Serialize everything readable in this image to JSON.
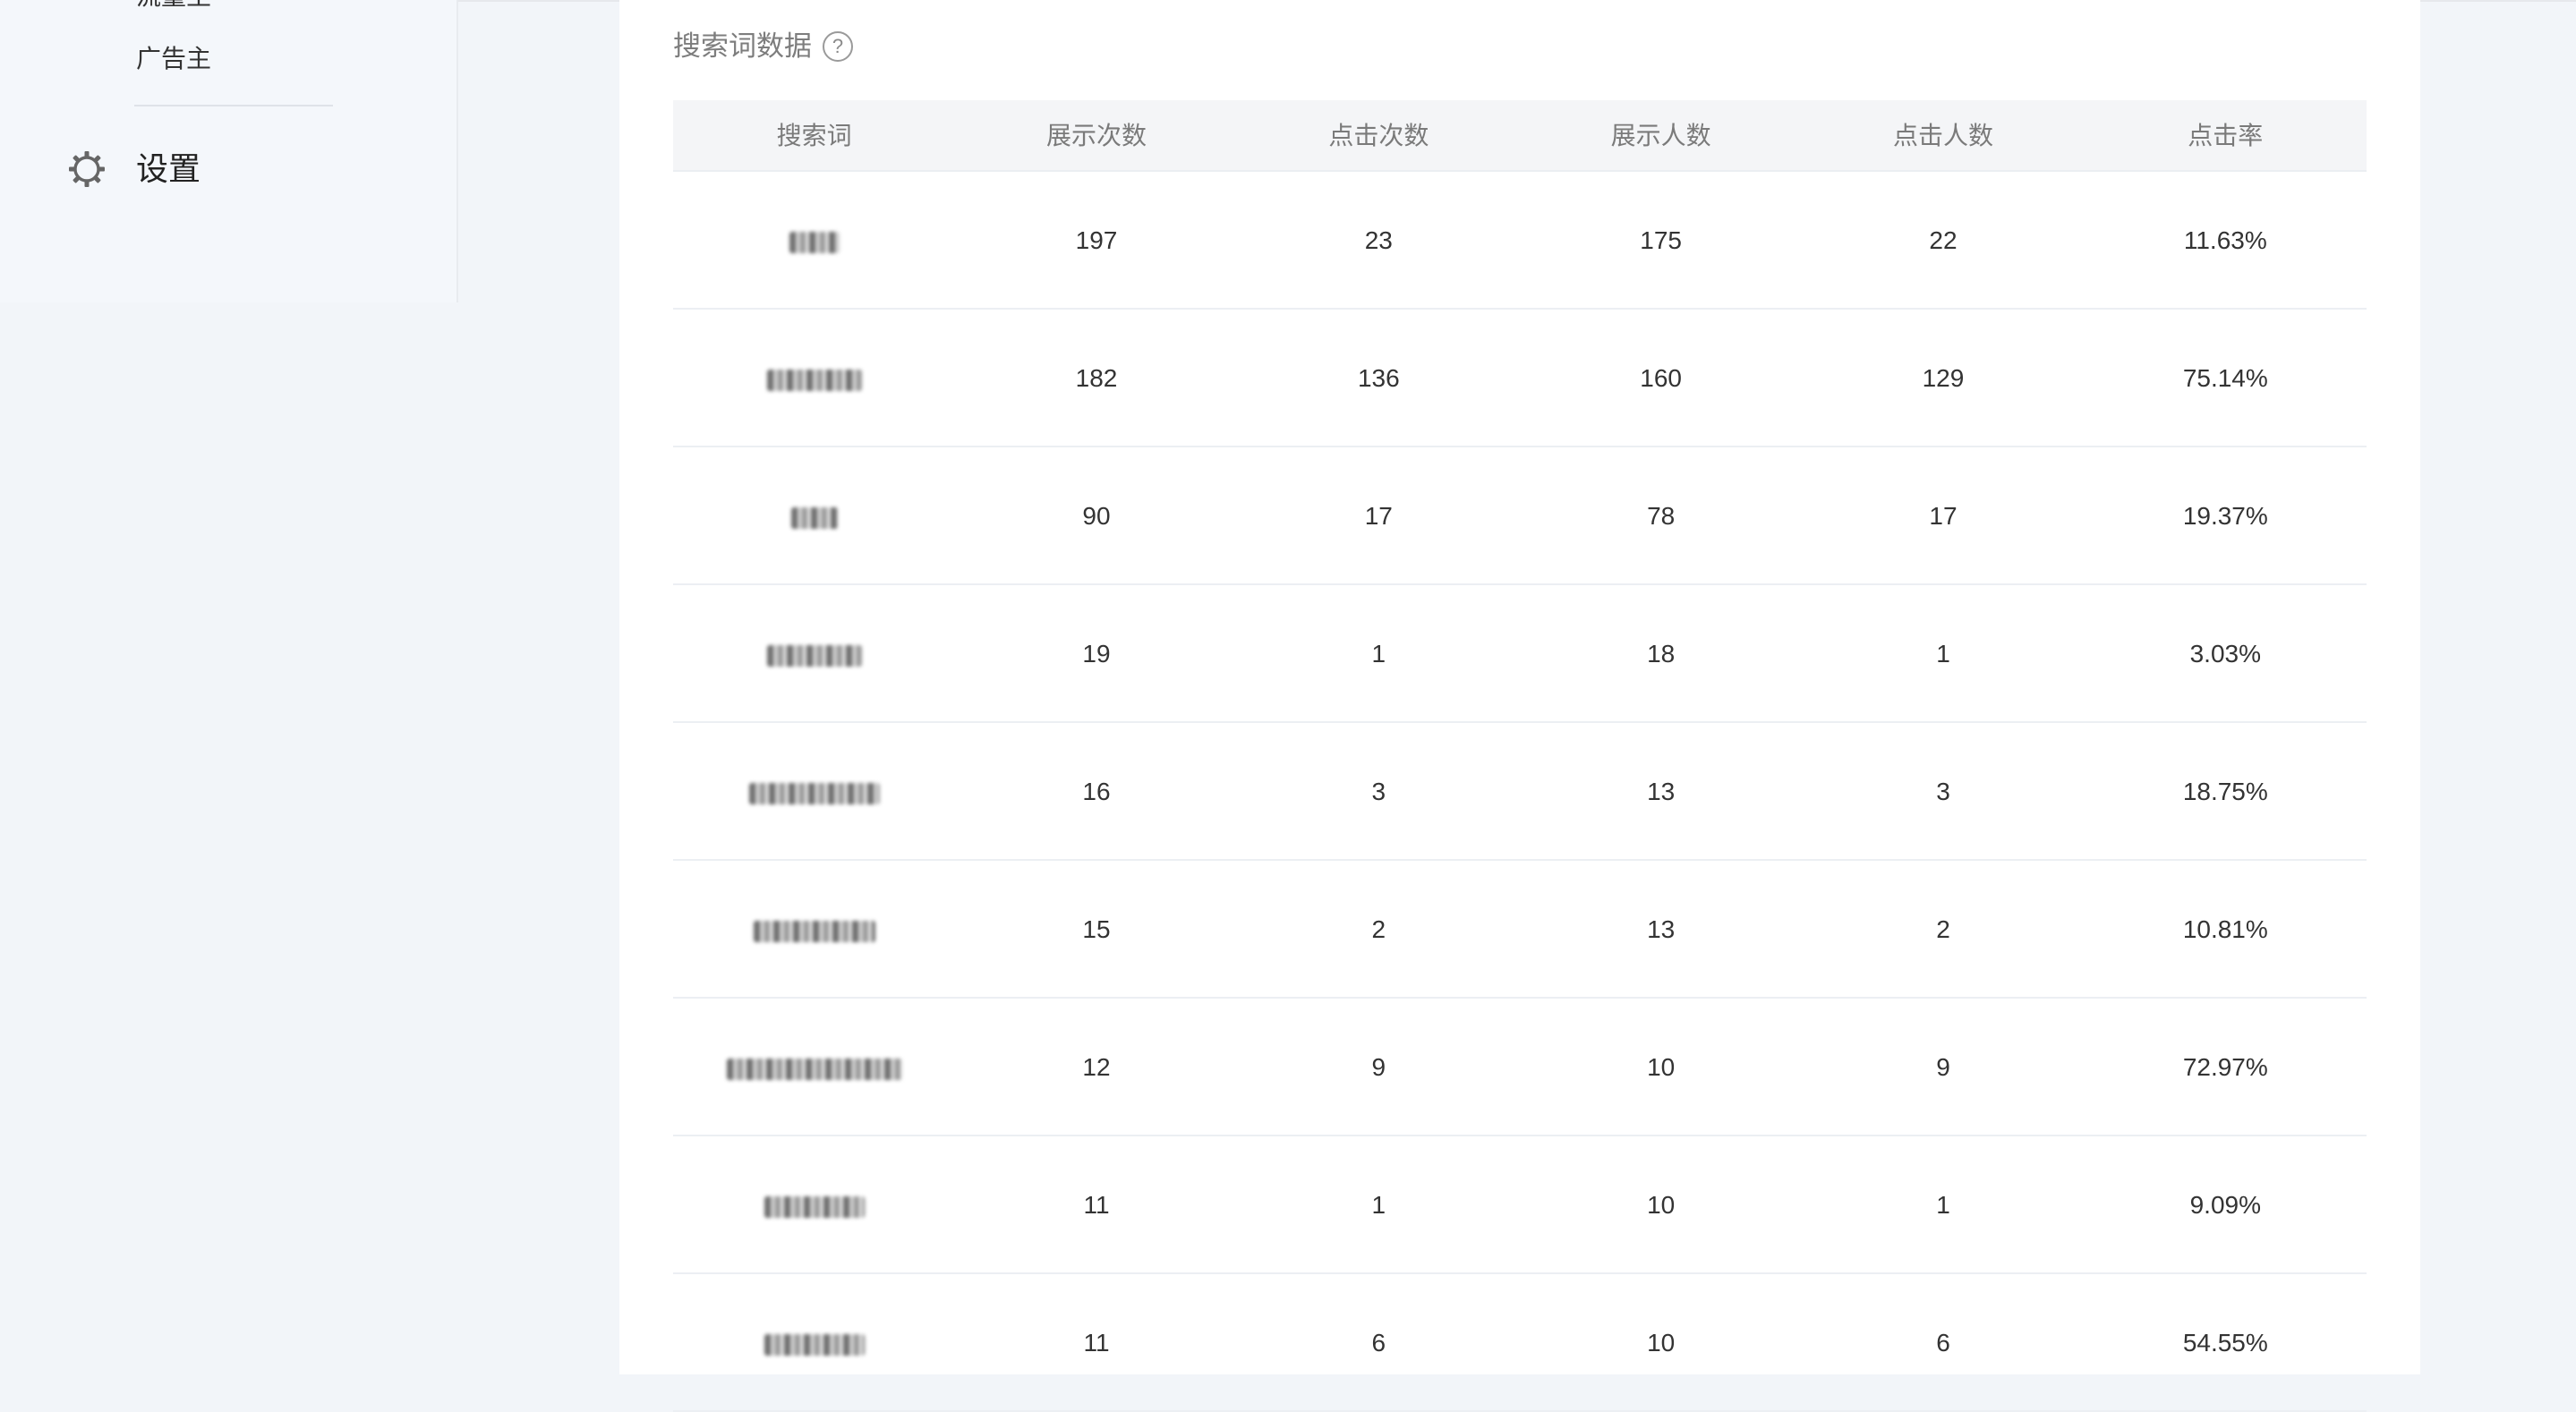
{
  "sidebar": {
    "submenu_cut_label": "流量主",
    "submenu_item_label": "广告主",
    "settings_label": "设置"
  },
  "section": {
    "title": "搜索词数据",
    "help_icon": "question-circle-icon"
  },
  "table": {
    "columns": [
      "搜索词",
      "展示次数",
      "点击次数",
      "展示人数",
      "点击人数",
      "点击率"
    ],
    "rows": [
      {
        "keyword": "",
        "impressions": "197",
        "clicks": "23",
        "impression_users": "175",
        "click_users": "22",
        "ctr": "11.63%"
      },
      {
        "keyword": "",
        "impressions": "182",
        "clicks": "136",
        "impression_users": "160",
        "click_users": "129",
        "ctr": "75.14%"
      },
      {
        "keyword": "",
        "impressions": "90",
        "clicks": "17",
        "impression_users": "78",
        "click_users": "17",
        "ctr": "19.37%"
      },
      {
        "keyword": "",
        "impressions": "19",
        "clicks": "1",
        "impression_users": "18",
        "click_users": "1",
        "ctr": "3.03%"
      },
      {
        "keyword": "",
        "impressions": "16",
        "clicks": "3",
        "impression_users": "13",
        "click_users": "3",
        "ctr": "18.75%"
      },
      {
        "keyword": "",
        "impressions": "15",
        "clicks": "2",
        "impression_users": "13",
        "click_users": "2",
        "ctr": "10.81%"
      },
      {
        "keyword": "",
        "impressions": "12",
        "clicks": "9",
        "impression_users": "10",
        "click_users": "9",
        "ctr": "72.97%"
      },
      {
        "keyword": "",
        "impressions": "11",
        "clicks": "1",
        "impression_users": "10",
        "click_users": "1",
        "ctr": "9.09%"
      },
      {
        "keyword": "",
        "impressions": "11",
        "clicks": "6",
        "impression_users": "10",
        "click_users": "6",
        "ctr": "54.55%"
      }
    ]
  },
  "colors": {
    "background": "#f2f5f9",
    "card": "#ffffff",
    "header_bg": "#f4f5f7",
    "text_primary": "#333333",
    "text_muted": "#7a7a7a"
  }
}
